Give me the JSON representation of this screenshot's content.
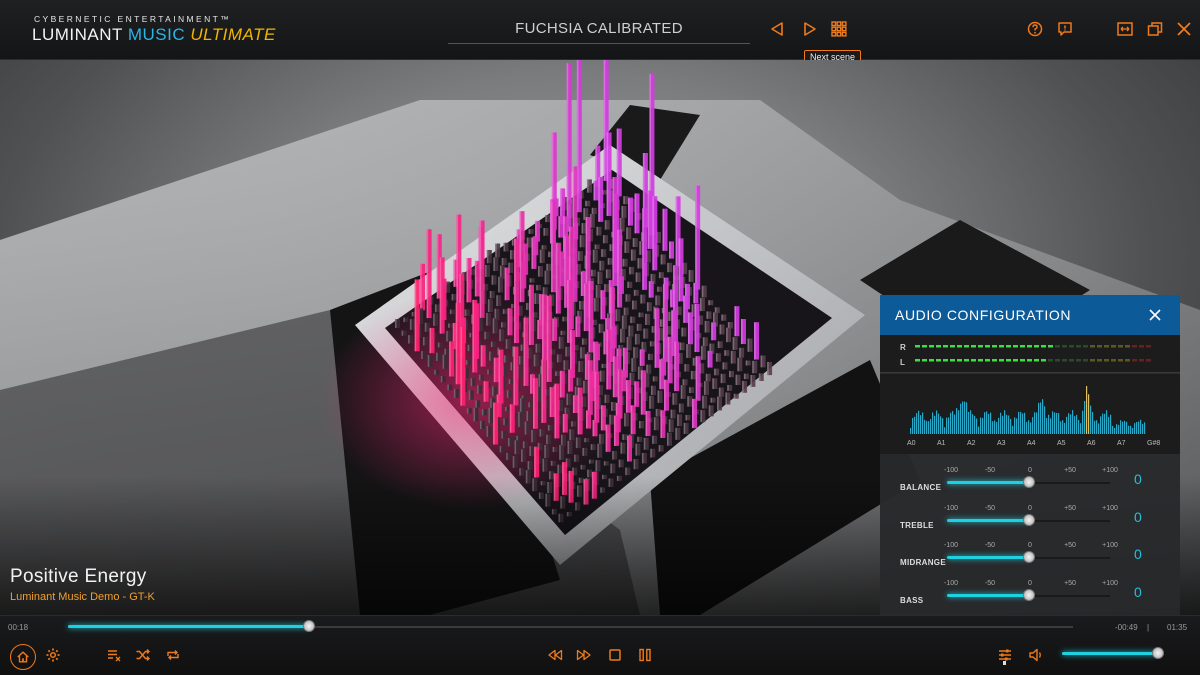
{
  "app": {
    "logo_top": "CYBERNETIC ENTERTAINMENT™",
    "logo_word1": "LUMINANT ",
    "logo_word2": "MUSIC ",
    "logo_word3": "ULTIMATE",
    "scene_title": "FUCHSIA CALIBRATED",
    "tooltip": "Next scene"
  },
  "icons": {
    "prev_scene": "triangle-left-icon",
    "next_scene": "triangle-right-icon",
    "scenes_grid": "grid-icon",
    "help": "question-circle-icon",
    "feedback": "chat-icon",
    "fit": "fit-window-icon",
    "windowed": "restore-window-icon",
    "close": "close-icon"
  },
  "colors": {
    "accent": "#f07a1a",
    "cyan": "#1fd0e0",
    "panel_header": "#0d5a99",
    "logo_blue": "#29b6e8",
    "logo_yellow": "#f0b400",
    "bar_pink": "#ff1f6e",
    "bar_magenta": "#d23cdf"
  },
  "track": {
    "title": "Positive Energy",
    "subtitle": "Luminant Music Demo - GT-K"
  },
  "audio_panel": {
    "title": "AUDIO CONFIGURATION",
    "vu_right": "R",
    "vu_left": "L",
    "vu_levels": {
      "R": 0.58,
      "L": 0.55
    },
    "notes": [
      "A0",
      "A1",
      "A2",
      "A3",
      "A4",
      "A5",
      "A6",
      "A7",
      "G#8"
    ],
    "ticks": [
      "-100",
      "-50",
      "0",
      "+50",
      "+100"
    ],
    "eq": [
      {
        "name": "BALANCE",
        "value": "0",
        "level": 0
      },
      {
        "name": "TREBLE",
        "value": "0",
        "level": 0
      },
      {
        "name": "MIDRANGE",
        "value": "0",
        "level": 0
      },
      {
        "name": "BASS",
        "value": "0",
        "level": 0
      }
    ]
  },
  "playback": {
    "elapsed": "00:18",
    "remaining": "-00:49",
    "separator": "|",
    "total": "01:35",
    "progress": 0.24,
    "volume": 0.94
  }
}
